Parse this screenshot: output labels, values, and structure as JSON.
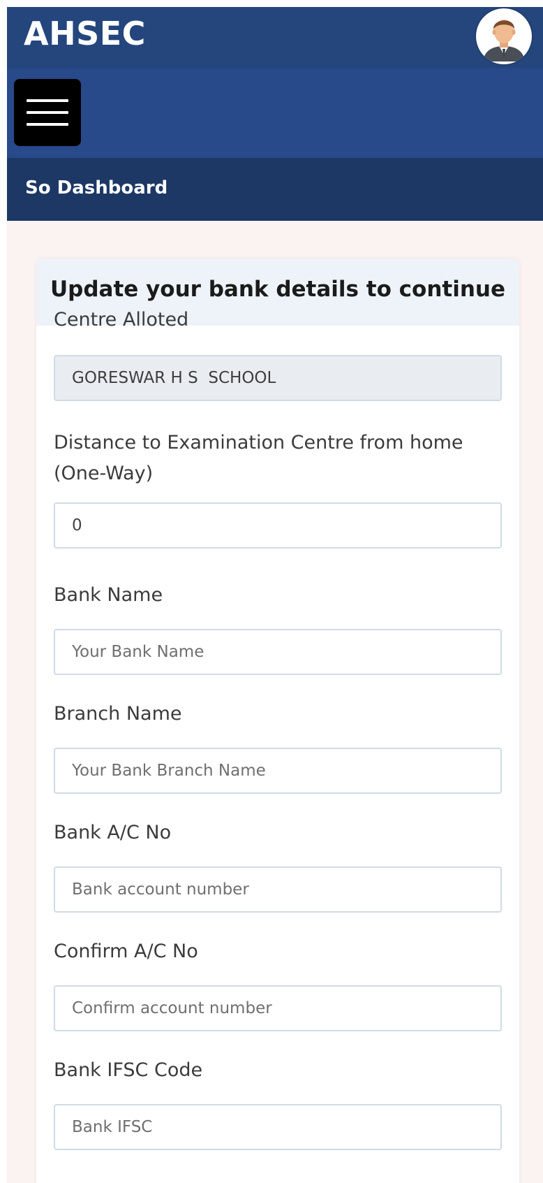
{
  "header": {
    "brand": "AHSEC"
  },
  "subheader": {
    "title": "So Dashboard"
  },
  "form": {
    "title": "Update your bank details to continue",
    "centre": {
      "label": "Centre Alloted",
      "value": "GORESWAR H S  SCHOOL"
    },
    "distance": {
      "label": "Distance to Examination Centre from home (One-Way)",
      "value": "0"
    },
    "bank_name": {
      "label": "Bank Name",
      "placeholder": "Your Bank Name"
    },
    "branch_name": {
      "label": "Branch Name",
      "placeholder": "Your Bank Branch Name"
    },
    "account_no": {
      "label": "Bank A/C No",
      "placeholder": "Bank account number"
    },
    "confirm_account_no": {
      "label": "Confirm A/C No",
      "placeholder": "Confirm account number"
    },
    "ifsc": {
      "label": "Bank IFSC Code",
      "placeholder": "Bank IFSC"
    }
  },
  "icons": {
    "menu": "hamburger-menu-icon",
    "avatar": "user-avatar-icon"
  },
  "colors": {
    "topbar": "#25467d",
    "navbar": "#28498a",
    "subbar": "#1d3865",
    "page_background": "#fbf3f1",
    "card_header": "#eef3f9",
    "input_border": "#cfdbe6",
    "readonly_input": "#e9edf2"
  }
}
